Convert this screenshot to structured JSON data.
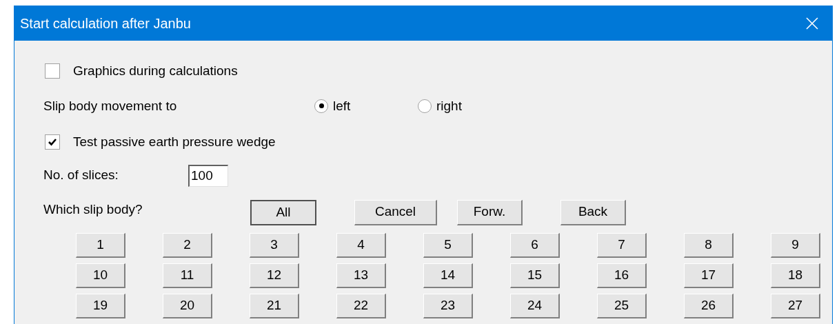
{
  "window": {
    "title": "Start calculation after Janbu"
  },
  "graphics_option": {
    "label": "Graphics during calculations",
    "checked": false
  },
  "movement": {
    "label": "Slip body movement to",
    "options": [
      {
        "label": "left",
        "selected": true
      },
      {
        "label": "right",
        "selected": false
      }
    ]
  },
  "passive_option": {
    "label": "Test passive earth pressure wedge",
    "checked": true
  },
  "slices": {
    "label": "No. of slices:",
    "value": "100"
  },
  "slip_body": {
    "label": "Which slip body?",
    "buttons": [
      {
        "label": "All",
        "default": true
      },
      {
        "label": "Cancel",
        "default": false
      },
      {
        "label": "Forw.",
        "default": false
      },
      {
        "label": "Back",
        "default": false
      }
    ],
    "numbers": [
      "1",
      "2",
      "3",
      "4",
      "5",
      "6",
      "7",
      "8",
      "9",
      "10",
      "11",
      "12",
      "13",
      "14",
      "15",
      "16",
      "17",
      "18",
      "19",
      "20",
      "21",
      "22",
      "23",
      "24",
      "25",
      "26",
      "27"
    ]
  }
}
